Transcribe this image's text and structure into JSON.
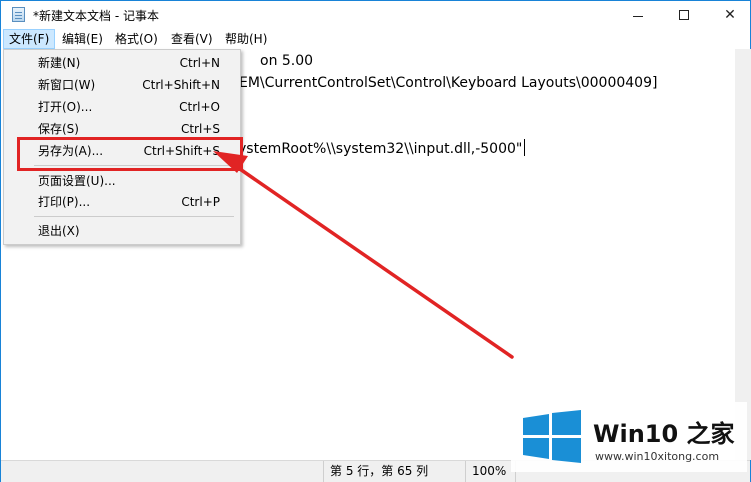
{
  "window": {
    "title": "*新建文本文档 - 记事本",
    "border_color": "#1883d7"
  },
  "menubar": {
    "items": [
      {
        "label": "文件(F)",
        "active": true
      },
      {
        "label": "编辑(E)",
        "active": false
      },
      {
        "label": "格式(O)",
        "active": false
      },
      {
        "label": "查看(V)",
        "active": false
      },
      {
        "label": "帮助(H)",
        "active": false
      }
    ]
  },
  "file_menu": {
    "items": [
      {
        "label": "新建(N)",
        "shortcut": "Ctrl+N"
      },
      {
        "label": "新窗口(W)",
        "shortcut": "Ctrl+Shift+N"
      },
      {
        "label": "打开(O)...",
        "shortcut": "Ctrl+O"
      },
      {
        "label": "保存(S)",
        "shortcut": "Ctrl+S"
      },
      {
        "label": "另存为(A)...",
        "shortcut": "Ctrl+Shift+S",
        "highlighted": true
      },
      {
        "label": "页面设置(U)...",
        "shortcut": ""
      },
      {
        "label": "打印(P)...",
        "shortcut": "Ctrl+P"
      },
      {
        "label": "退出(X)",
        "shortcut": ""
      }
    ]
  },
  "editor": {
    "lines": [
      "on 5.00",
      "EM\\CurrentControlSet\\Control\\Keyboard Layouts\\00000409]",
      "",
      "",
      "ystemRoot%\\\\system32\\\\input.dll,-5000\""
    ]
  },
  "statusbar": {
    "position": "第 5 行，第 65 列",
    "zoom": "100%"
  },
  "annotation": {
    "color": "#e12424"
  },
  "watermark": {
    "brand_prefix": "Win10",
    "brand_suffix": " 之家",
    "url": "www.win10xitong.com",
    "logo_color": "#1a8fd6"
  }
}
